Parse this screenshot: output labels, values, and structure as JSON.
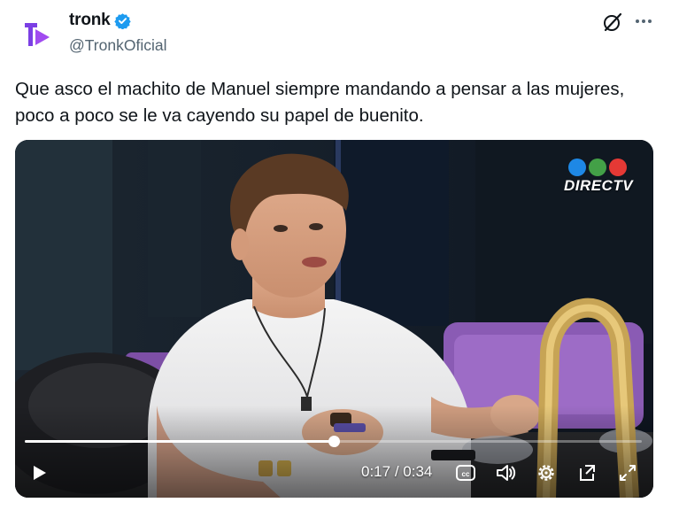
{
  "account": {
    "display_name": "tronk",
    "handle": "@TronkOficial",
    "verified": true,
    "verified_color": "#1d9bf0",
    "avatar_color": "#7b3fe4"
  },
  "header_icons": [
    "grok-icon",
    "more-icon"
  ],
  "tweet": {
    "lines": [
      "Que asco el machito de Manuel siempre mandando a pensar a las mujeres,",
      "poco a poco se le va cayendo su papel de buenito."
    ]
  },
  "video": {
    "channel_logo": "DIRECTV",
    "logo_dot_colors": [
      "#1e88e5",
      "#43a047",
      "#e53935"
    ],
    "current_time": "0:17",
    "duration": "0:34",
    "time_display": "0:17 / 0:34",
    "progress_fraction": 0.5,
    "controls": [
      "play-icon",
      "captions-icon",
      "volume-icon",
      "settings-icon",
      "pop-out-icon",
      "fullscreen-icon"
    ]
  }
}
